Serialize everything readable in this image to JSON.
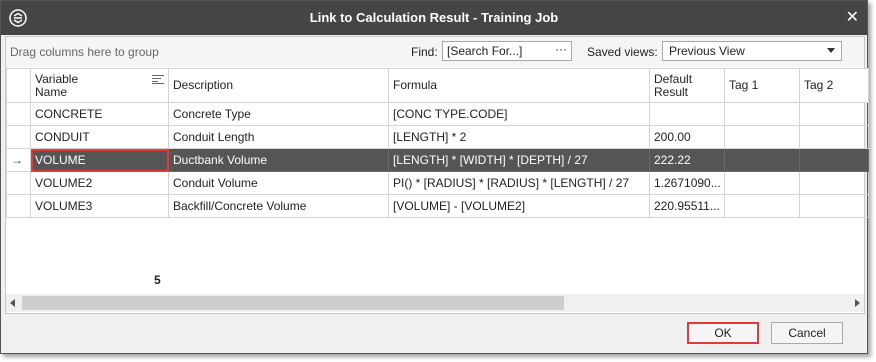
{
  "window": {
    "title": "Link to Calculation Result - Training Job",
    "logo_icon": "app-logo-icon",
    "close_glyph": "✕"
  },
  "toolbar": {
    "group_hint": "Drag columns here to group",
    "find_label": "Find:",
    "find_value": "[Search For...]",
    "find_more": "···",
    "saved_views_label": "Saved views:",
    "saved_views_value": "Previous View"
  },
  "grid": {
    "columns": [
      {
        "line1": "Variable",
        "line2": "Name"
      },
      {
        "line1": "Description",
        "line2": ""
      },
      {
        "line1": "Formula",
        "line2": ""
      },
      {
        "line1": "Default",
        "line2": "Result"
      },
      {
        "line1": "Tag 1",
        "line2": ""
      },
      {
        "line1": "Tag 2",
        "line2": ""
      }
    ],
    "rows": [
      {
        "indicator": "",
        "name": "CONCRETE",
        "description": "Concrete Type",
        "formula": "[CONC TYPE.CODE]",
        "result": "",
        "tag1": "",
        "tag2": ""
      },
      {
        "indicator": "",
        "name": "CONDUIT",
        "description": "Conduit Length",
        "formula": "[LENGTH] * 2",
        "result": "200.00",
        "tag1": "",
        "tag2": ""
      },
      {
        "indicator": "→",
        "name": "VOLUME",
        "description": "Ductbank Volume",
        "formula": "[LENGTH] * [WIDTH] * [DEPTH] / 27",
        "result": "222.22",
        "tag1": "",
        "tag2": ""
      },
      {
        "indicator": "",
        "name": "VOLUME2",
        "description": "Conduit Volume",
        "formula": "PI() * [RADIUS] * [RADIUS] * [LENGTH] / 27",
        "result": "1.2671090...",
        "tag1": "",
        "tag2": ""
      },
      {
        "indicator": "",
        "name": "VOLUME3",
        "description": "Backfill/Concrete Volume",
        "formula": "[VOLUME] - [VOLUME2]",
        "result": "220.95511...",
        "tag1": "",
        "tag2": ""
      }
    ],
    "selected_row": 2,
    "count": "5",
    "colors": {
      "selected_row_bg": "#555555",
      "highlight": "#e03a3a",
      "title_bar": "#454545"
    }
  },
  "buttons": {
    "ok": "OK",
    "cancel": "Cancel"
  }
}
